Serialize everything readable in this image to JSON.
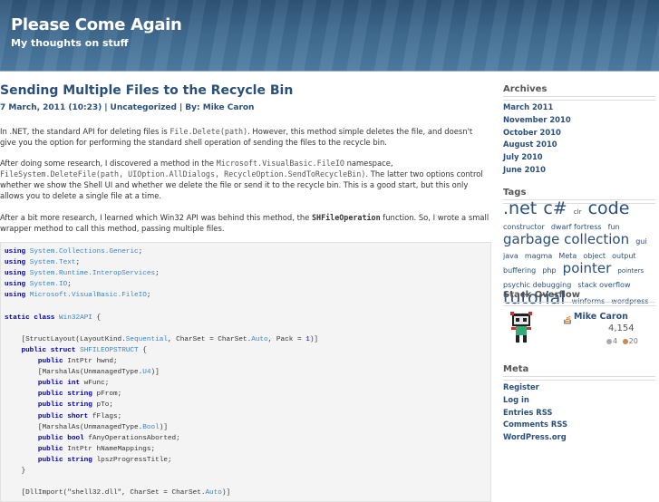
{
  "site": {
    "title": "Please Come Again",
    "description": "My thoughts on stuff"
  },
  "post": {
    "title": "Sending Multiple Files to the Recycle Bin",
    "date": "7 March, 2011 (10:23)",
    "category": "Uncategorized",
    "author": "By: Mike Caron",
    "p1": {
      "a": "In .NET, the standard API for deleting files is ",
      "code": "File.Delete(path)",
      "b": ". However, this method simple deletes the file, and doesn't give you the option for performing the standard shell operation of sending the files to the recycle bin."
    },
    "p2": {
      "a": "After doing some research, I discovered a method in the ",
      "code1": "Microsoft.VisualBasic.FileIO",
      "b": " namespace, ",
      "code2": "FileSystem.DeleteFile(path, UIOption.AllDialogs, RecycleOption.SendToRecycleBin)",
      "c": ". The latter two options control whether we show the Shell UI and whether we delete the file or send it to the recycle bin. This is a good start, but this only allows you to delete a single file at a time."
    },
    "p3": {
      "a": "After a bit more research, I learned which Win32 API was behind this method, the ",
      "code": "SHFileOperation",
      "b": " function. So, I wrote a small wrapper method to call this method, passing multiple files."
    }
  },
  "code_lines": [
    "using System.Collections.Generic;",
    "using System.Text;",
    "using System.Runtime.InteropServices;",
    "using System.IO;",
    "using Microsoft.VisualBasic.FileIO;",
    "",
    "static class Win32API {",
    "",
    "    [StructLayout(LayoutKind.Sequential, CharSet = CharSet.Auto, Pack = 1)]",
    "    public struct SHFILEOPSTRUCT {",
    "        public IntPtr hwnd;",
    "        [MarshalAs(UnmanagedType.U4)]",
    "        public int wFunc;",
    "        public string pFrom;",
    "        public string pTo;",
    "        public short fFlags;",
    "        [MarshalAs(UnmanagedType.Bool)]",
    "        public bool fAnyOperationsAborted;",
    "        public IntPtr hNameMappings;",
    "        public string lpszProgressTitle;",
    "    }",
    "",
    "    [DllImport(\"shell32.dll\", CharSet = CharSet.Auto)]"
  ],
  "sidebar": {
    "archives_title": "Archives",
    "archives": [
      "March 2011",
      "November 2010",
      "October 2010",
      "August 2010",
      "July 2010",
      "June 2010"
    ],
    "tags_title": "Tags",
    "tags": [
      {
        "label": ".net",
        "size": 19
      },
      {
        "label": "c#",
        "size": 19
      },
      {
        "label": "clr",
        "size": 7
      },
      {
        "label": "code",
        "size": 19
      },
      {
        "label": "constructor",
        "size": 8
      },
      {
        "label": "dwarf fortress",
        "size": 8
      },
      {
        "label": "fun",
        "size": 8
      },
      {
        "label": "garbage collection",
        "size": 15
      },
      {
        "label": "gui",
        "size": 8
      },
      {
        "label": "java",
        "size": 8
      },
      {
        "label": "magma",
        "size": 8
      },
      {
        "label": "Meta",
        "size": 8
      },
      {
        "label": "object",
        "size": 8
      },
      {
        "label": "output buffering",
        "size": 8
      },
      {
        "label": "php",
        "size": 8
      },
      {
        "label": "pointer",
        "size": 15
      },
      {
        "label": "pointers",
        "size": 7
      },
      {
        "label": "psychic debugging",
        "size": 8
      },
      {
        "label": "stack overflow",
        "size": 8
      },
      {
        "label": "tutorial",
        "size": 19
      },
      {
        "label": "winforms",
        "size": 8
      },
      {
        "label": "wordpress",
        "size": 8
      }
    ],
    "so_title": "Stack Overflow",
    "so": {
      "name": "Mike Caron",
      "rep": "4,154",
      "silver": "4",
      "bronze": "20"
    },
    "meta_title": "Meta",
    "meta": [
      "Register",
      "Log in",
      "Entries RSS",
      "Comments RSS",
      "WordPress.org"
    ]
  },
  "colors": {
    "header": "#3f6a90",
    "link": "#2a4f7a",
    "code_bg": "#f4f4f4"
  }
}
